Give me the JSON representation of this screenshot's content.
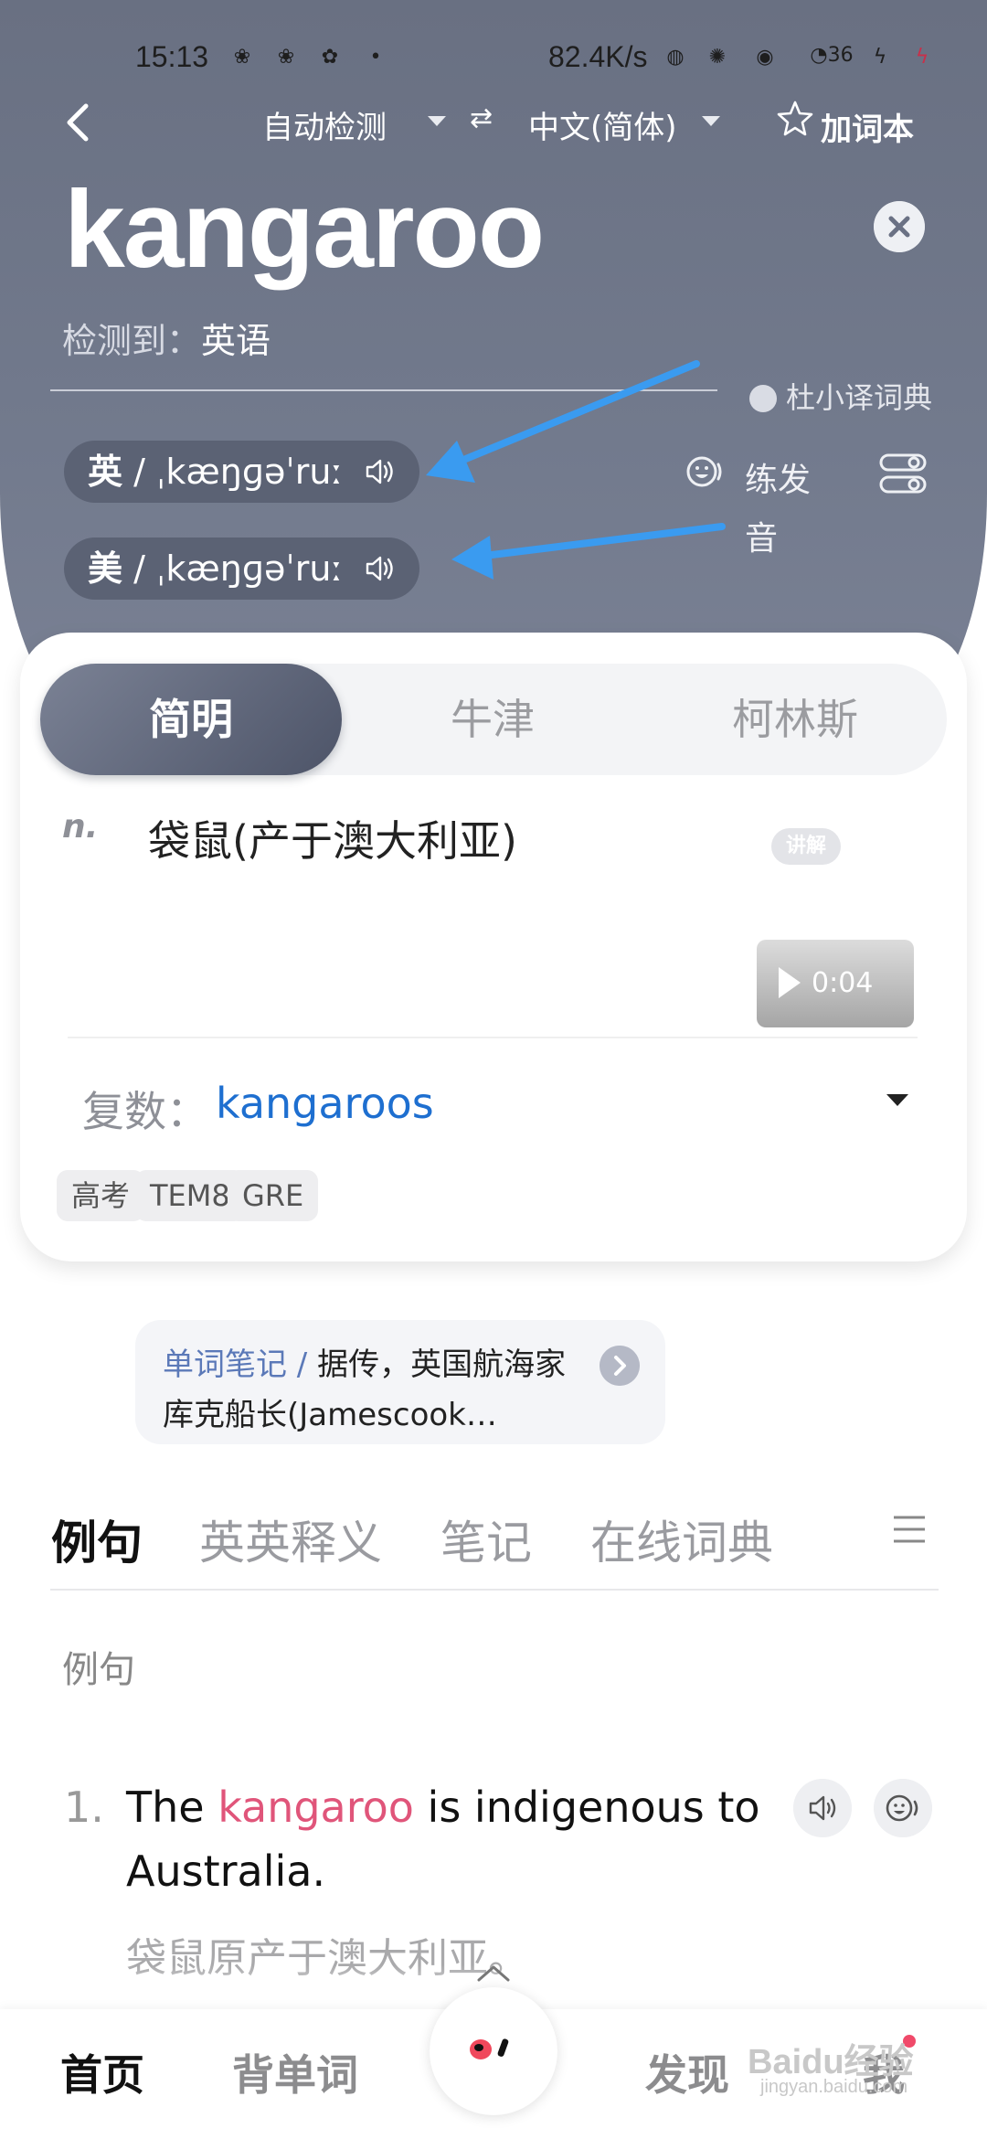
{
  "status_bar": {
    "time": "15:13",
    "speed": "82.4K/s",
    "battery": "36"
  },
  "header": {
    "source_language": "自动检测",
    "target_language": "中文(简体)",
    "add_vocab_label": "加词本",
    "word": "kangaroo",
    "detected_label": "检测到：",
    "detected_value": "英语",
    "dictionary_source": "杜小译词典",
    "practice_label": "练发音"
  },
  "pronunciations": [
    {
      "tag": "英",
      "sep": " / ",
      "ipa": "ˌkæŋɡəˈruː"
    },
    {
      "tag": "美",
      "sep": " / ",
      "ipa": "ˌkæŋɡəˈruː"
    }
  ],
  "dict_tabs": [
    "简明",
    "牛津",
    "柯林斯"
  ],
  "definition": {
    "pos": "n.",
    "meaning": "袋鼠(产于澳大利亚)",
    "explain_label": "讲解",
    "video_duration": "0:04",
    "plural_label": "复数：",
    "plural_value": "kangaroos",
    "tags": [
      "高考",
      "TEM8",
      "GRE"
    ]
  },
  "note": {
    "label": "单词笔记 / ",
    "text": "据传，英国航海家库克船长(Jamescook…"
  },
  "section_tabs": [
    "例句",
    "英英释义",
    "笔记",
    "在线词典"
  ],
  "examples": {
    "heading": "例句",
    "items": [
      {
        "num": "1.",
        "before": "The ",
        "highlight": "kangaroo",
        "after": " is indigenous to Australia.",
        "translation": "袋鼠原产于澳大利亚。"
      }
    ]
  },
  "bottom_nav": [
    "首页",
    "背单词",
    "发现",
    "我"
  ],
  "watermark": "Baidu经验",
  "watermark_sub": "jingyan.baidu.com",
  "colors": {
    "header_bg": "#6f7689",
    "highlight": "#e0557a",
    "link": "#1e6fd0",
    "annotation_arrow": "#3a9bf0"
  }
}
